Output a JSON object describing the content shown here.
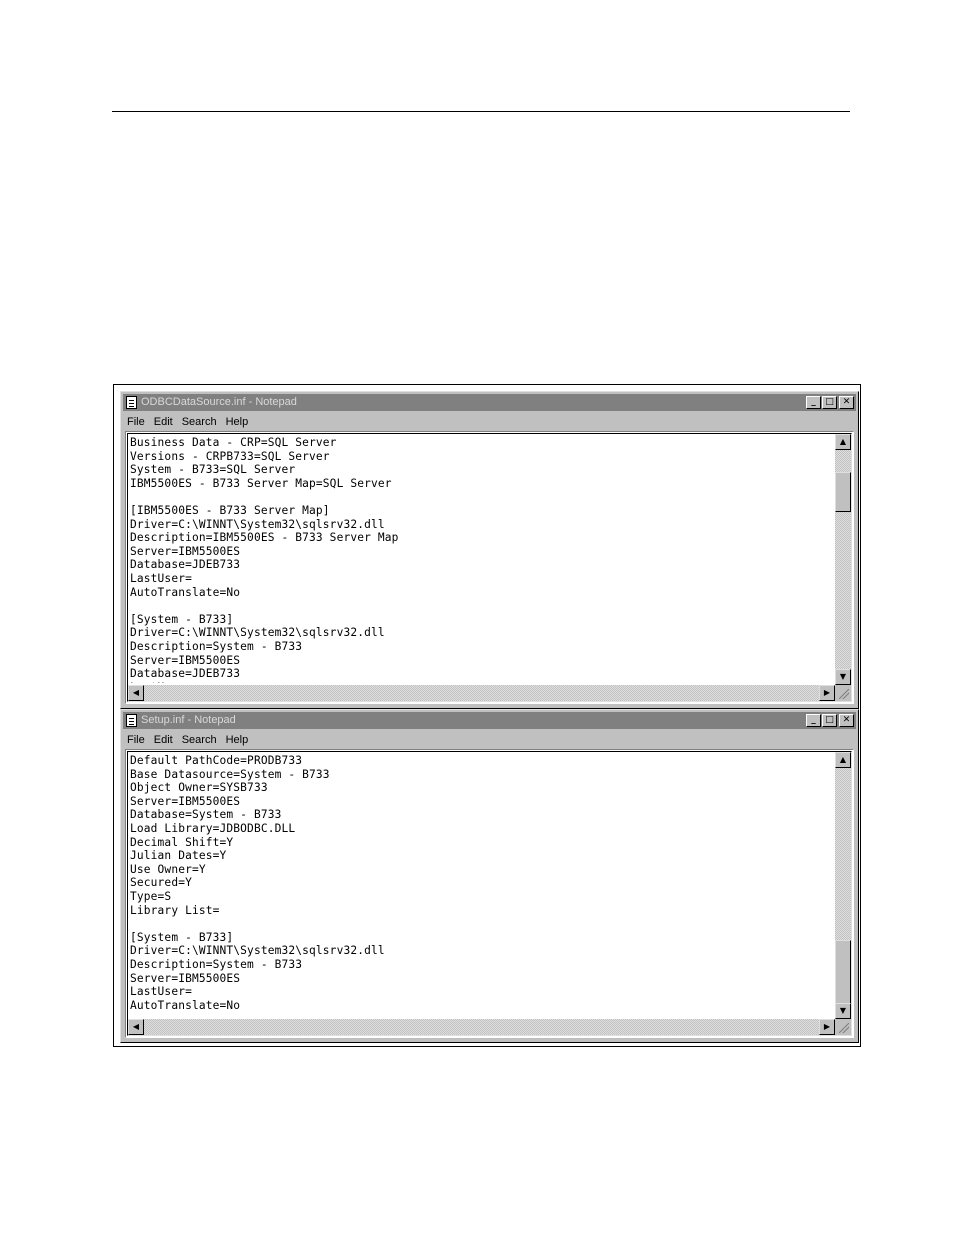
{
  "windows": [
    {
      "title": "ODBCDataSource.inf - Notepad",
      "menu": [
        "File",
        "Edit",
        "Search",
        "Help"
      ],
      "lines": [
        "Business Data - CRP=SQL Server",
        "Versions - CRPB733=SQL Server",
        "System - B733=SQL Server",
        "IBM5500ES - B733 Server Map=SQL Server",
        "",
        "[IBM5500ES - B733 Server Map]",
        "Driver=C:\\WINNT\\System32\\sqlsrv32.dll",
        "Description=IBM5500ES - B733 Server Map",
        "Server=IBM5500ES",
        "Database=JDEB733",
        "LastUser=",
        "AutoTranslate=No",
        "",
        "[System - B733]",
        "Driver=C:\\WINNT\\System32\\sqlsrv32.dll",
        "Description=System - B733",
        "Server=IBM5500ES",
        "Database=JDEB733",
        "LastUser="
      ]
    },
    {
      "title": "Setup.inf - Notepad",
      "menu": [
        "File",
        "Edit",
        "Search",
        "Help"
      ],
      "lines": [
        "Default PathCode=PRODB733",
        "Base Datasource=System - B733",
        "Object Owner=SYSB733",
        "Server=IBM5500ES",
        "Database=System - B733",
        "Load Library=JDBODBC.DLL",
        "Decimal Shift=Y",
        "Julian Dates=Y",
        "Use Owner=Y",
        "Secured=Y",
        "Type=S",
        "Library List=",
        "",
        "[System - B733]",
        "Driver=C:\\WINNT\\System32\\sqlsrv32.dll",
        "Description=System - B733",
        "Server=IBM5500ES",
        "LastUser=",
        "AutoTranslate=No"
      ]
    }
  ],
  "window_buttons": {
    "minimize": "_",
    "maximize": "□",
    "close": "✕"
  },
  "scroll_glyphs": {
    "up": "▲",
    "down": "▼",
    "left": "◀",
    "right": "▶"
  }
}
